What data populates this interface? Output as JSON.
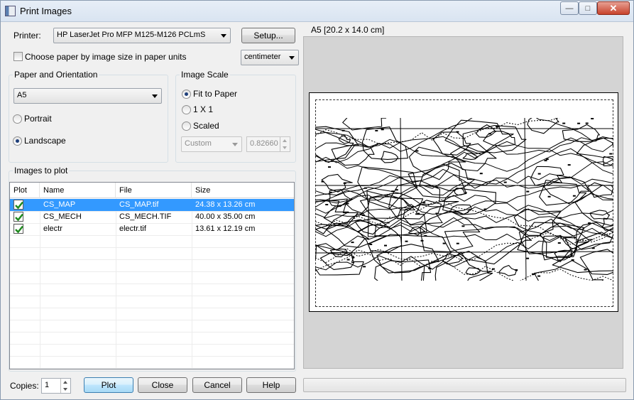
{
  "window": {
    "title": "Print Images",
    "controls": {
      "minimize": "—",
      "maximize": "□",
      "close": "✕"
    }
  },
  "printer": {
    "label": "Printer:",
    "selected": "HP LaserJet Pro MFP M125-M126 PCLmS",
    "setup_button": "Setup..."
  },
  "paper_by_image": {
    "label": "Choose paper by image size in paper units",
    "checked": false,
    "units": "centimeter"
  },
  "paper_orientation": {
    "title": "Paper and Orientation",
    "paper": "A5",
    "portrait_label": "Portrait",
    "landscape_label": "Landscape",
    "selected": "Landscape"
  },
  "image_scale": {
    "title": "Image Scale",
    "fit_label": "Fit to Paper",
    "one_label": "1 X 1",
    "scaled_label": "Scaled",
    "selected": "Fit to Paper",
    "scale_combo": "Custom",
    "scale_value": "0.82660"
  },
  "images": {
    "title": "Images to plot",
    "columns": [
      "Plot",
      "Name",
      "File",
      "Size"
    ],
    "rows": [
      {
        "plot": true,
        "name": "CS_MAP",
        "file": "CS_MAP.tif",
        "size": "24.38 x 13.26 cm",
        "selected": true
      },
      {
        "plot": true,
        "name": "CS_MECH",
        "file": "CS_MECH.TIF",
        "size": "40.00 x 35.00 cm",
        "selected": false
      },
      {
        "plot": true,
        "name": "electr",
        "file": "electr.tif",
        "size": "13.61 x 12.19 cm",
        "selected": false
      }
    ]
  },
  "preview": {
    "caption": "A5 [20.2 x 14.0 cm]"
  },
  "footer": {
    "copies_label": "Copies:",
    "copies_value": "1",
    "plot_button": "Plot",
    "close_button": "Close",
    "cancel_button": "Cancel",
    "help_button": "Help"
  },
  "colors": {
    "selection": "#3399ff",
    "check_green": "#1f8a1f",
    "preview_bg": "#d4d4d4"
  }
}
